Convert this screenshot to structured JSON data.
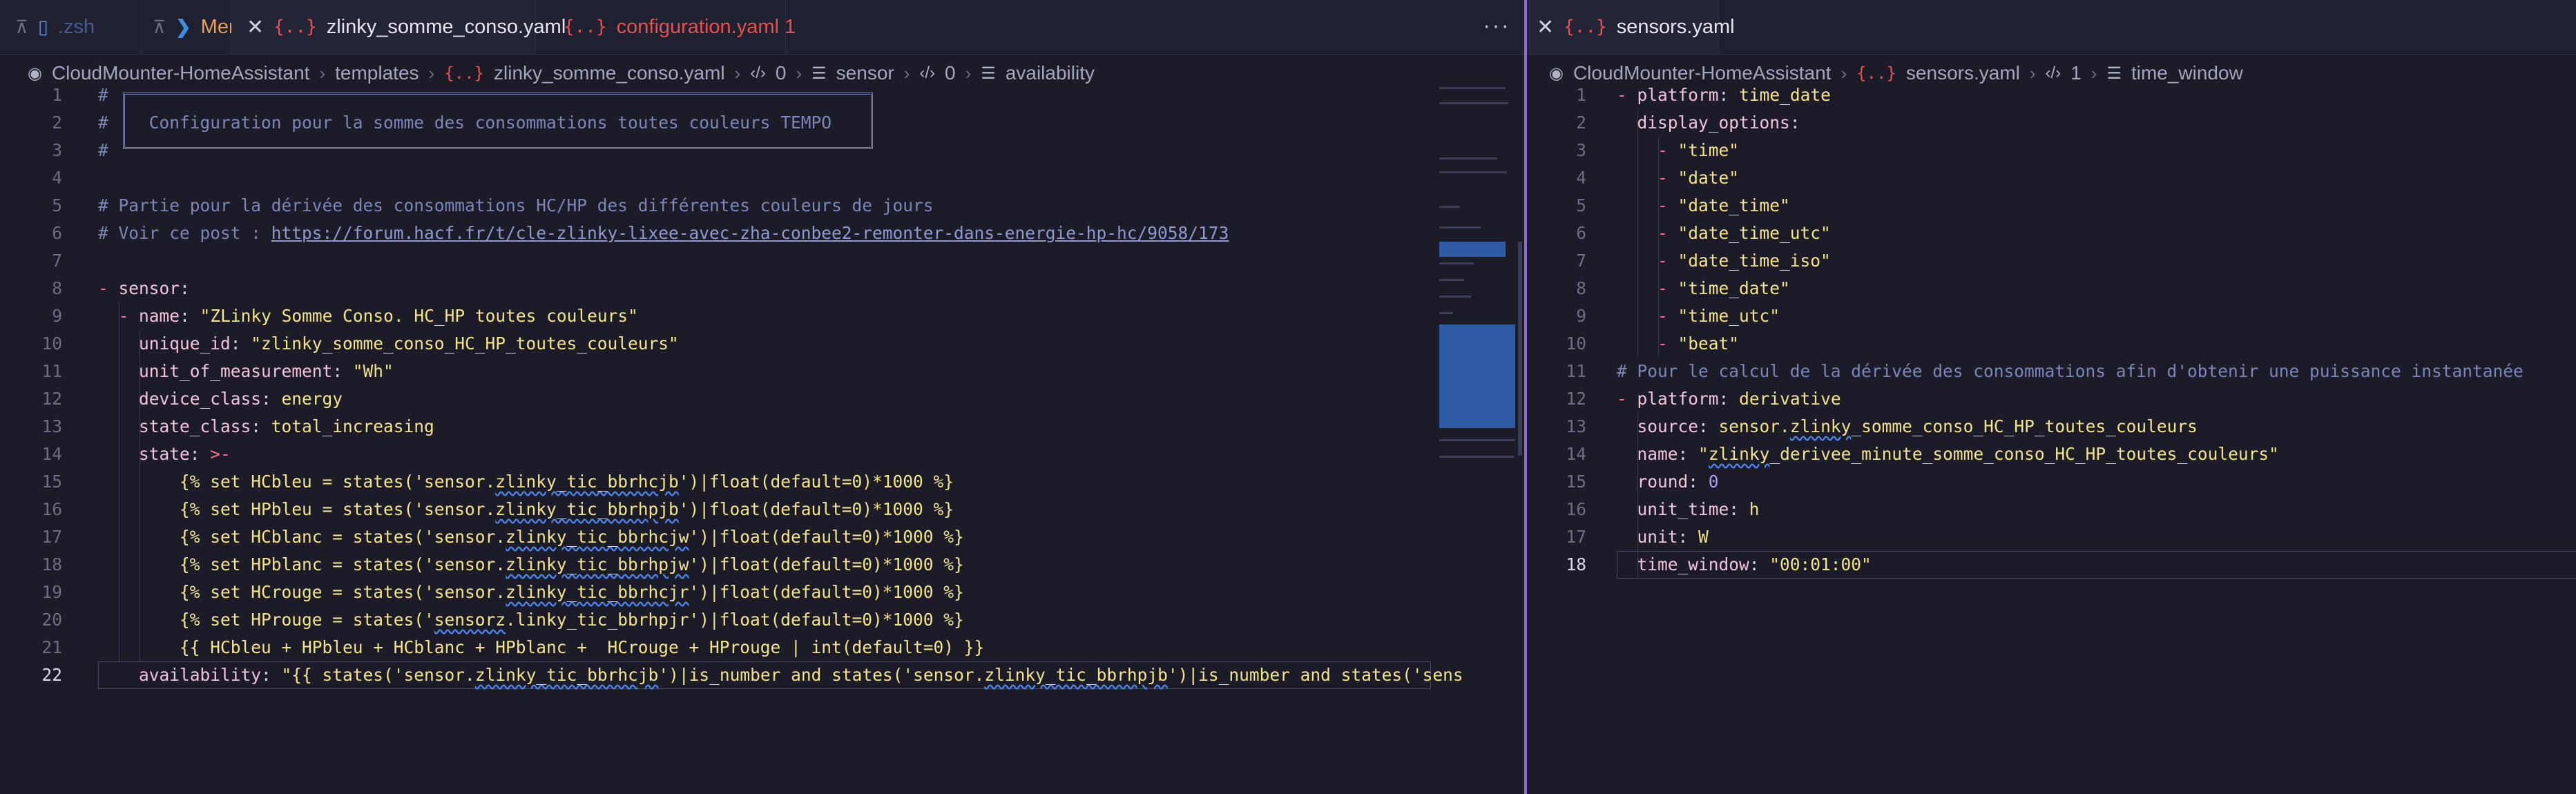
{
  "left": {
    "tabs": [
      {
        "name": ".zsh",
        "kind": "file"
      },
      {
        "name": "Mer",
        "kind": "ps"
      },
      {
        "name": "zlinky_somme_conso.yaml",
        "kind": "yaml-active"
      },
      {
        "name": "configuration.yaml 1",
        "kind": "yaml-modified"
      }
    ],
    "more": "···",
    "breadcrumb": [
      "CloudMounter-HomeAssistant",
      "templates",
      "zlinky_somme_conso.yaml",
      "0",
      "sensor",
      "0",
      "availability"
    ],
    "lines": [
      {
        "n": "1"
      },
      {
        "n": "2"
      },
      {
        "n": "3"
      },
      {
        "n": "4"
      },
      {
        "n": "5"
      },
      {
        "n": "6"
      },
      {
        "n": "7"
      },
      {
        "n": "8"
      },
      {
        "n": "9"
      },
      {
        "n": "10"
      },
      {
        "n": "11"
      },
      {
        "n": "12"
      },
      {
        "n": "13"
      },
      {
        "n": "14"
      },
      {
        "n": "15"
      },
      {
        "n": "16"
      },
      {
        "n": "17"
      },
      {
        "n": "18"
      },
      {
        "n": "19"
      },
      {
        "n": "20"
      },
      {
        "n": "21"
      },
      {
        "n": "22"
      }
    ],
    "code": {
      "l1": "#",
      "l2_hash": "#",
      "l2_text": "Configuration pour la somme des consommations toutes couleurs TEMPO",
      "l3": "#",
      "l5": "# Partie pour la dérivée des consommations HC/HP des différentes couleurs de jours",
      "l6_prefix": "# Voir ce post : ",
      "l6_url": "https://forum.hacf.fr/t/cle-zlinky-lixee-avec-zha-conbee2-remonter-dans-energie-hp-hc/9058/173",
      "l8_dash": "-",
      "l8_key": "sensor",
      "l9_key": "name",
      "l9_val": "\"ZLinky Somme Conso. HC_HP toutes couleurs\"",
      "l10_key": "unique_id",
      "l10_val": "\"zlinky_somme_conso_HC_HP_toutes_couleurs\"",
      "l11_key": "unit_of_measurement",
      "l11_val": "\"Wh\"",
      "l12_key": "device_class",
      "l12_val": "energy",
      "l13_key": "state_class",
      "l13_val": "total_increasing",
      "l14_key": "state",
      "l14_val": ">-",
      "l15a": "{% set HCbleu = states('sensor.",
      "l15b": "zlinky_tic_bbrhcjb",
      "l15c": "')|float(default=0)*1000 %}",
      "l16a": "{% set HPbleu = states('sensor.",
      "l16b": "zlinky_tic_bbrhpjb",
      "l16c": "')|float(default=0)*1000 %}",
      "l17a": "{% set HCblanc = states('sensor.",
      "l17b": "zlinky_tic_bbrhcjw",
      "l17c": "')|float(default=0)*1000 %}",
      "l18a": "{% set HPblanc = states('sensor.",
      "l18b": "zlinky_tic_bbrhpjw",
      "l18c": "')|float(default=0)*1000 %}",
      "l19a": "{% set HCrouge = states('sensor.",
      "l19b": "zlinky_tic_bbrhcjr",
      "l19c": "')|float(default=0)*1000 %}",
      "l20a": "{% set HProuge = states('",
      "l20b": "sensorz",
      "l20c": ".linky_tic_bbrhpjr')|float(default=0)*1000 %}",
      "l21": "{{ HCbleu + HPbleu + HCblanc + HPblanc +  HCrouge + HProuge | int(default=0) }}",
      "l22_key": "availability",
      "l22a": "\"{{ states('sensor.",
      "l22b": "zlinky_tic_bbrhcjb",
      "l22c": "')|is_number and states('sensor.",
      "l22d": "zlinky_tic_bbrhpjb",
      "l22e": "')|is_number and states('sens"
    }
  },
  "right": {
    "tab": "sensors.yaml",
    "breadcrumb": [
      "CloudMounter-HomeAssistant",
      "sensors.yaml",
      "1",
      "time_window"
    ],
    "lines": [
      {
        "n": "1"
      },
      {
        "n": "2"
      },
      {
        "n": "3"
      },
      {
        "n": "4"
      },
      {
        "n": "5"
      },
      {
        "n": "6"
      },
      {
        "n": "7"
      },
      {
        "n": "8"
      },
      {
        "n": "9"
      },
      {
        "n": "10"
      },
      {
        "n": "11"
      },
      {
        "n": "12"
      },
      {
        "n": "13"
      },
      {
        "n": "14"
      },
      {
        "n": "15"
      },
      {
        "n": "16"
      },
      {
        "n": "17"
      },
      {
        "n": "18"
      }
    ],
    "code": {
      "r1_key": "platform",
      "r1_val": "time_date",
      "r2_key": "display_options",
      "r3": "\"time\"",
      "r4": "\"date\"",
      "r5": "\"date_time\"",
      "r6": "\"date_time_utc\"",
      "r7": "\"date_time_iso\"",
      "r8": "\"time_date\"",
      "r9": "\"time_utc\"",
      "r10": "\"beat\"",
      "r11": "# Pour le calcul de la dérivée des consommations afin d'obtenir une puissance instantanée",
      "r12_key": "platform",
      "r12_val": "derivative",
      "r13_key": "source",
      "r13_a": "sensor.",
      "r13_b": "zlinky",
      "r13_c": "_somme_conso_HC_HP_toutes_couleurs",
      "r14_key": "name",
      "r14_a": "\"",
      "r14_b": "zlinky",
      "r14_c": "_derivee_minute_somme_conso_HC_HP_toutes_couleurs\"",
      "r15_key": "round",
      "r15_val": "0",
      "r16_key": "unit_time",
      "r16_val": "h",
      "r17_key": "unit",
      "r17_val": "W",
      "r18_key": "time_window",
      "r18_val": "\"00:01:00\""
    }
  }
}
